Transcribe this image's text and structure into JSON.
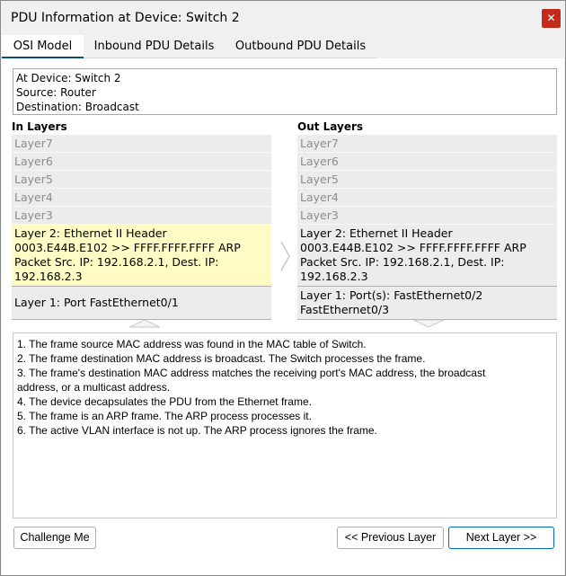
{
  "window": {
    "title": "PDU Information at Device: Switch 2",
    "close_label": "✕"
  },
  "tabs": [
    {
      "label": "OSI Model"
    },
    {
      "label": "Inbound PDU Details"
    },
    {
      "label": "Outbound PDU Details"
    }
  ],
  "info": {
    "device": "At Device: Switch 2",
    "source": "Source: Router",
    "destination": "Destination: Broadcast"
  },
  "in_layers": {
    "title": "In Layers",
    "upper": [
      "Layer7",
      "Layer6",
      "Layer5",
      "Layer4",
      "Layer3"
    ],
    "layer2": [
      "Layer 2: Ethernet II Header",
      "0003.E44B.E102 >> FFFF.FFFF.FFFF ARP",
      "Packet Src. IP: 192.168.2.1, Dest. IP:",
      "192.168.2.3"
    ],
    "layer1": [
      "Layer 1: Port FastEthernet0/1"
    ]
  },
  "out_layers": {
    "title": "Out Layers",
    "upper": [
      "Layer7",
      "Layer6",
      "Layer5",
      "Layer4",
      "Layer3"
    ],
    "layer2": [
      "Layer 2: Ethernet II Header",
      "0003.E44B.E102 >> FFFF.FFFF.FFFF ARP",
      "Packet Src. IP: 192.168.2.1, Dest. IP:",
      "192.168.2.3"
    ],
    "layer1": [
      "Layer 1: Port(s): FastEthernet0/2",
      "FastEthernet0/3"
    ]
  },
  "steps": [
    "1. The frame source MAC address was found in the MAC table of Switch.",
    "2. The frame destination MAC address is broadcast. The Switch processes the frame.",
    "3. The frame's destination MAC address matches the receiving port's MAC address, the broadcast",
    "address, or a multicast address.",
    "4. The device decapsulates the PDU from the Ethernet frame.",
    "5. The frame is an ARP frame. The ARP process processes it.",
    "6. The active VLAN interface is not up. The ARP process ignores the frame."
  ],
  "buttons": {
    "challenge": "Challenge Me",
    "previous": "<< Previous Layer",
    "next": "Next Layer >>"
  },
  "colors": {
    "accent": "#0067c0",
    "highlight": "#fffbc5",
    "close": "#c42b1c"
  }
}
